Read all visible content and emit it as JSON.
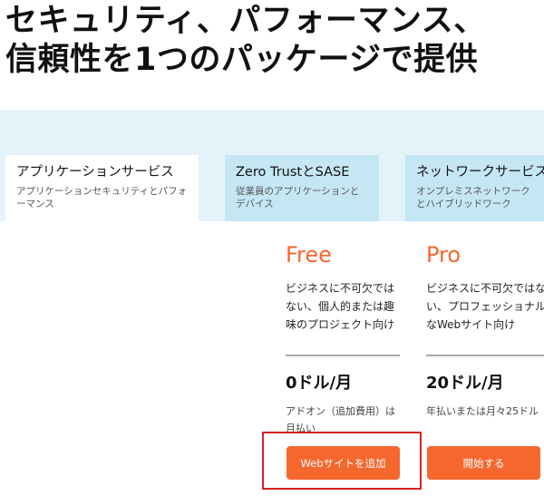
{
  "headline": {
    "line1": "セキュリティ、パフォーマンス、",
    "line2": "信頼性を1つのパッケージで提供"
  },
  "tabs": [
    {
      "title": "アプリケーションサービス",
      "description": "アプリケーションセキュリティとパフォーマンス",
      "active": true
    },
    {
      "title": "Zero TrustとSASE",
      "description": "従業員のアプリケーションとデバイス",
      "active": false
    },
    {
      "title": "ネットワークサービス",
      "description": "オンプレミスネットワークとハイブリッドワーク",
      "active": false
    }
  ],
  "plans": [
    {
      "name": "Free",
      "description": "ビジネスに不可欠ではない、個人的または趣味のプロジェクト向け",
      "price": "0ドル/月",
      "note": "アドオン（追加費用）は月払い",
      "button": "Webサイトを追加"
    },
    {
      "name": "Pro",
      "description": "ビジネスに不可欠ではない、プロフェッショナルなWebサイト向け",
      "price": "20ドル/月",
      "note": "年払いまたは月々25ドル",
      "button": "開始する"
    }
  ],
  "colors": {
    "accent": "#f6672e",
    "band": "#e4f3fa",
    "tab_inactive": "#c5e6f3",
    "highlight": "#d42020"
  }
}
